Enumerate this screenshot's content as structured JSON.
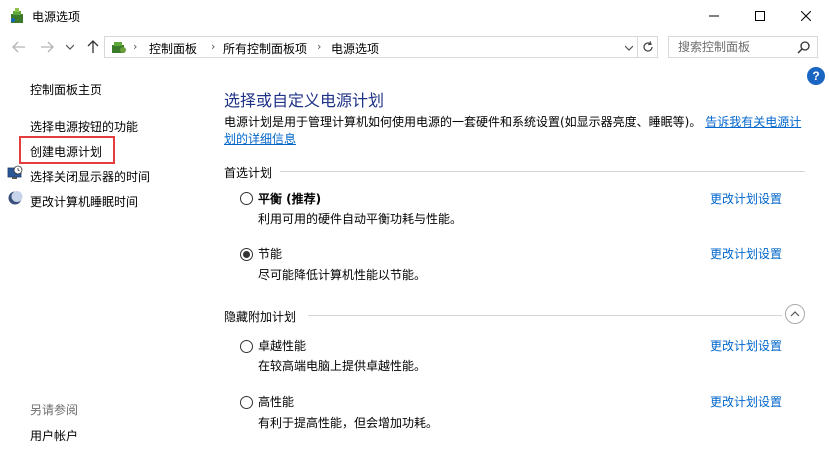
{
  "window": {
    "title": "电源选项",
    "icon": "power-options-icon"
  },
  "address": {
    "crumbs": [
      "控制面板",
      "所有控制面板项",
      "电源选项"
    ],
    "search_placeholder": "搜索控制面板"
  },
  "help": {
    "label": "?"
  },
  "sidebar": {
    "home": "控制面板主页",
    "items": [
      {
        "label": "选择电源按钮的功能",
        "icon": ""
      },
      {
        "label": "创建电源计划",
        "icon": ""
      },
      {
        "label": "选择关闭显示器的时间",
        "icon": "monitor-clock-icon"
      },
      {
        "label": "更改计算机睡眠时间",
        "icon": "moon-icon"
      }
    ],
    "see_also_title": "另请参阅",
    "see_also_items": [
      "用户帐户"
    ]
  },
  "main": {
    "title": "选择或自定义电源计划",
    "description": "电源计划是用于管理计算机如何使用电源的一套硬件和系统设置(如显示器亮度、睡眠等)。",
    "description_link": "告诉我有关电源计划的详细信息",
    "preferred_title": "首选计划",
    "hidden_title": "隐藏附加计划",
    "change_settings_label": "更改计划设置",
    "preferred_plans": [
      {
        "name": "平衡 (推荐)",
        "desc": "利用可用的硬件自动平衡功耗与性能。",
        "selected": false
      },
      {
        "name": "节能",
        "desc": "尽可能降低计算机性能以节能。",
        "selected": true
      }
    ],
    "hidden_plans": [
      {
        "name": "卓越性能",
        "desc": "在较高端电脑上提供卓越性能。",
        "selected": false
      },
      {
        "name": "高性能",
        "desc": "有利于提高性能，但会增加功耗。",
        "selected": false
      }
    ]
  },
  "colors": {
    "title_blue": "#1e3287",
    "link_blue": "#0066cc",
    "highlight_red": "#e53c3c"
  }
}
